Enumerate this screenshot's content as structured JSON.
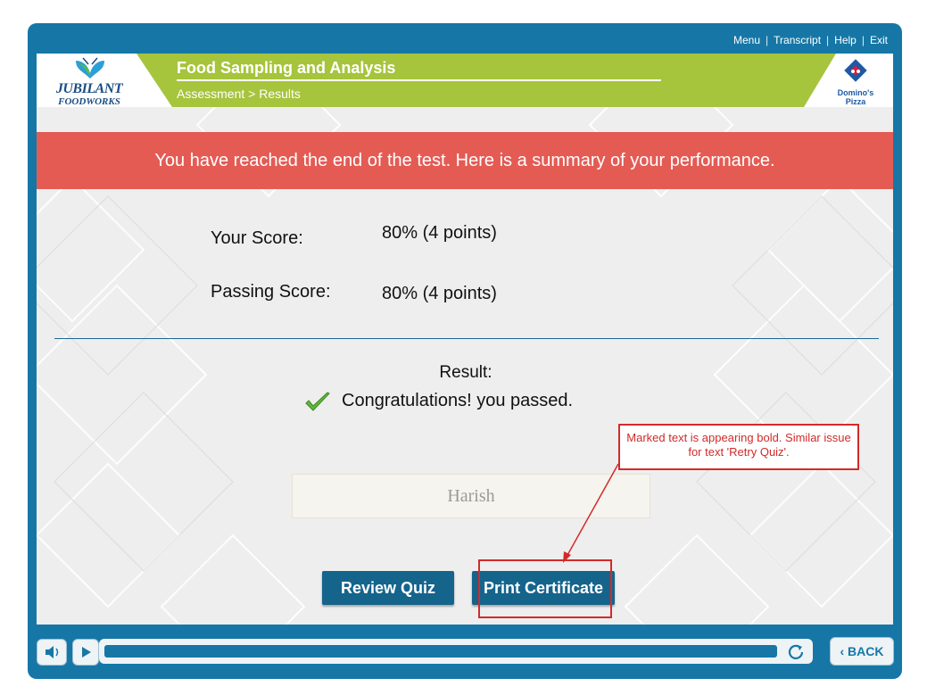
{
  "nav": {
    "menu": "Menu",
    "transcript": "Transcript",
    "help": "Help",
    "exit": "Exit",
    "separator": "|"
  },
  "header": {
    "course_title": "Food Sampling and Analysis",
    "breadcrumb": "Assessment > Results",
    "left_logo": {
      "line1": "JUBILANT",
      "line2": "FOODWORKS"
    },
    "right_logo": {
      "line1": "Domino's",
      "line2": "Pizza"
    }
  },
  "banner": {
    "text": "You have reached the end of the test. Here is a summary of your performance."
  },
  "score": {
    "your_score_label": "Your Score:",
    "your_score_value": "80% (4 points)",
    "passing_label": "Passing Score:",
    "passing_value": "80% (4 points)"
  },
  "result": {
    "label": "Result:",
    "message": "Congratulations! you passed."
  },
  "name_field": {
    "value": "Harish"
  },
  "annotation": {
    "text": "Marked text is appearing bold. Similar issue for text 'Retry Quiz'."
  },
  "buttons": {
    "review": "Review Quiz",
    "print": "Print Certificate"
  },
  "player": {
    "back": "BACK"
  },
  "colors": {
    "frame": "#1677a7",
    "banner": "#e45b54",
    "header_green": "#a6c43c",
    "button": "#15648c",
    "annotation": "#d22a2a"
  }
}
